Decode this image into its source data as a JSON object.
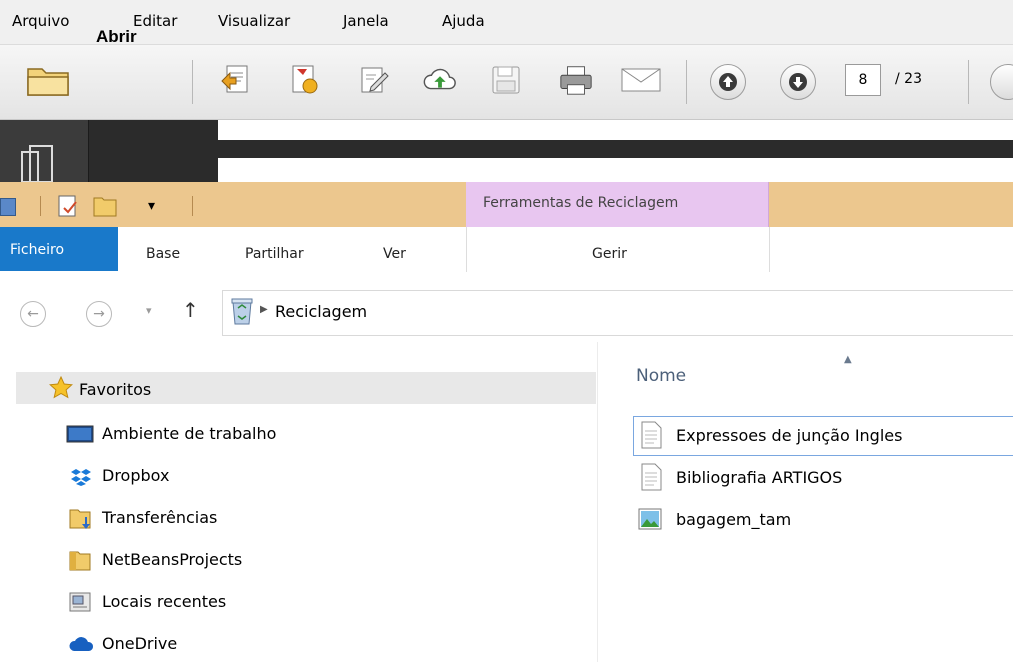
{
  "reader": {
    "menu": [
      {
        "label": "Arquivo"
      },
      {
        "label": "Editar"
      },
      {
        "label": "Visualizar"
      },
      {
        "label": "Janela"
      },
      {
        "label": "Ajuda"
      }
    ],
    "toolbar": {
      "open_label": "Abrir",
      "page_current": "8",
      "page_total": "/ 23"
    }
  },
  "explorer": {
    "ribbon": {
      "contextual_group": "Ferramentas de Reciclagem",
      "tabs": {
        "file": "Ficheiro",
        "home": "Base",
        "share": "Partilhar",
        "view": "Ver",
        "manage": "Gerir"
      }
    },
    "address": {
      "location": "Reciclagem"
    },
    "nav": {
      "favorites": "Favoritos",
      "items": [
        {
          "label": "Ambiente de trabalho",
          "icon": "desktop-icon"
        },
        {
          "label": "Dropbox",
          "icon": "dropbox-icon"
        },
        {
          "label": "Transferências",
          "icon": "downloads-folder-icon"
        },
        {
          "label": "NetBeansProjects",
          "icon": "folder-icon"
        },
        {
          "label": "Locais recentes",
          "icon": "recent-places-icon"
        },
        {
          "label": "OneDrive",
          "icon": "onedrive-icon"
        }
      ]
    },
    "list": {
      "column_name": "Nome",
      "files": [
        {
          "label": "Expressoes de junção Ingles",
          "icon": "text-file-icon"
        },
        {
          "label": "Bibliografia ARTIGOS",
          "icon": "text-file-icon"
        },
        {
          "label": "bagagem_tam",
          "icon": "image-file-icon"
        }
      ]
    }
  }
}
